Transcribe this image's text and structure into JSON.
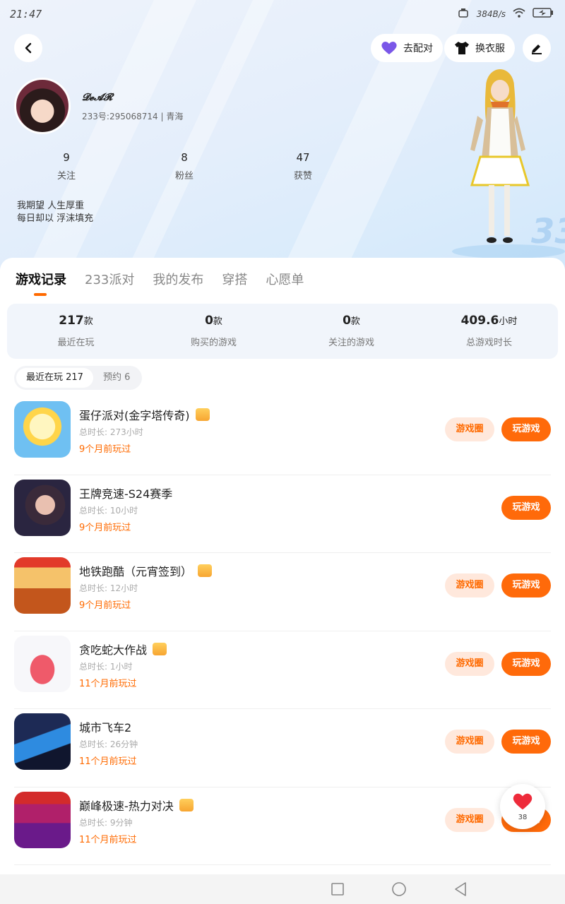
{
  "status_bar": {
    "time": "21:47",
    "net_speed": "384B/s"
  },
  "header": {
    "match_label": "去配对",
    "outfit_label": "换衣服",
    "nickname": "𝓓𝓮𝓐𝓡",
    "uid_line": "233号:295068714 | 青海",
    "stats": [
      {
        "num": "9",
        "label": "关注"
      },
      {
        "num": "8",
        "label": "粉丝"
      },
      {
        "num": "47",
        "label": "获赞"
      }
    ],
    "bio_line1": "我期望  人生厚重",
    "bio_line2": "每日却以  浮沫填充"
  },
  "tabs": [
    "游戏记录",
    "233派对",
    "我的发布",
    "穿搭",
    "心愿单"
  ],
  "summary": [
    {
      "value": "217",
      "unit": "款",
      "label": "最近在玩"
    },
    {
      "value": "0",
      "unit": "款",
      "label": "购买的游戏"
    },
    {
      "value": "0",
      "unit": "款",
      "label": "关注的游戏"
    },
    {
      "value": "409.6",
      "unit": "小时",
      "label": "总游戏时长"
    }
  ],
  "segment": {
    "recent": "最近在玩 217",
    "reserve": "预约 6"
  },
  "buttons": {
    "circle": "游戏圈",
    "play": "玩游戏"
  },
  "games": [
    {
      "title": "蛋仔派对(金字塔传奇)",
      "duration": "总时长: 273小时",
      "last": "9个月前玩过",
      "gift": true,
      "circle": true
    },
    {
      "title": "王牌竞速-S24赛季",
      "duration": "总时长: 10小时",
      "last": "9个月前玩过",
      "gift": false,
      "circle": false
    },
    {
      "title": "地铁跑酷（元宵签到）",
      "duration": "总时长: 12小时",
      "last": "9个月前玩过",
      "gift": true,
      "circle": true
    },
    {
      "title": "贪吃蛇大作战",
      "duration": "总时长: 1小时",
      "last": "11个月前玩过",
      "gift": true,
      "circle": true
    },
    {
      "title": "城市飞车2",
      "duration": "总时长: 26分钟",
      "last": "11个月前玩过",
      "gift": false,
      "circle": true
    },
    {
      "title": "巅峰极速-热力对决",
      "duration": "总时长: 9分钟",
      "last": "11个月前玩过",
      "gift": true,
      "circle": true
    }
  ],
  "float_count": "38",
  "accent_color": "#ff6a00"
}
